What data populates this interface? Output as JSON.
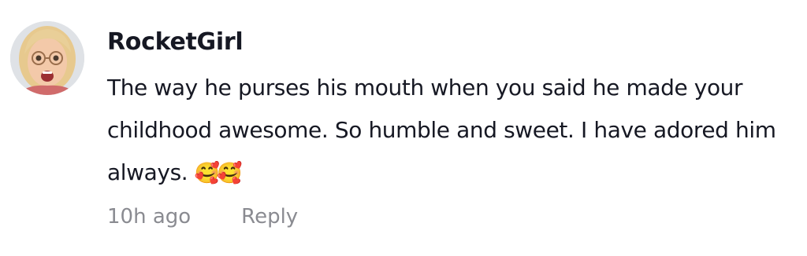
{
  "comment": {
    "username": "RocketGirl",
    "text": "The way he purses his mouth when you said he made your childhood awesome. So humble and sweet. I have adored him always.",
    "emoji": "🥰🥰",
    "timestamp": "10h ago",
    "reply_label": "Reply",
    "avatar_icon": "memoji-avatar-icon"
  },
  "colors": {
    "text_primary": "#161823",
    "text_secondary": "#8a8b91",
    "background": "#ffffff"
  }
}
